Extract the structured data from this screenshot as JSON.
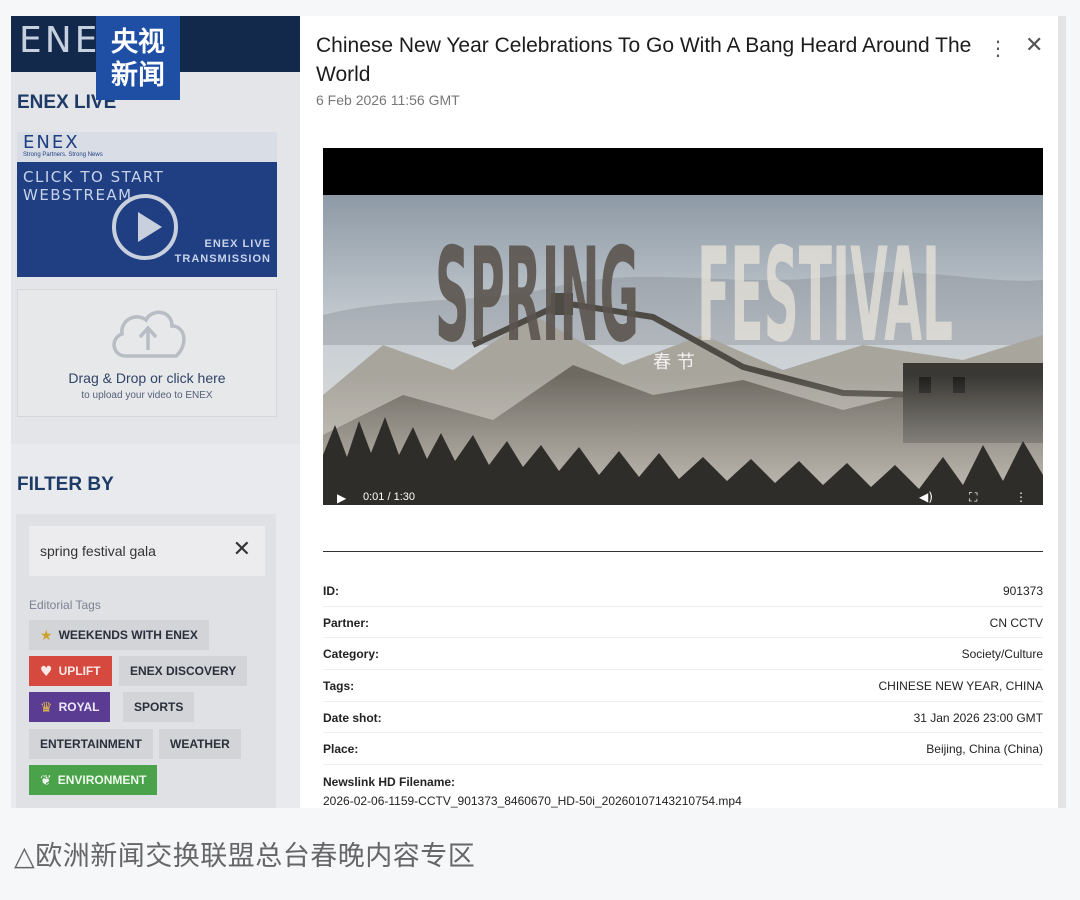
{
  "left_panel": {
    "logo_text": "ENEX",
    "cctv_badge_line1": "央视",
    "cctv_badge_line2": "新闻",
    "live_title": "ENEX LIVE",
    "stream": {
      "mini_logo": "ENEX",
      "tagline": "Strong Partners. Strong News",
      "click_text": "CLICK TO START WEBSTREAM",
      "live_line1": "ENEX LIVE",
      "live_line2": "TRANSMISSION"
    },
    "upload": {
      "icon": "cloud-upload-icon",
      "main": "Drag & Drop or click here",
      "sub": "to upload your video to ENEX"
    },
    "filter_title": "FILTER BY",
    "search_value": "spring festival gala",
    "editorial_tags_label": "Editorial Tags",
    "tags": {
      "weekends": "WEEKENDS WITH ENEX",
      "uplift": "UPLIFT",
      "discovery": "ENEX DISCOVERY",
      "royal": "ROYAL",
      "sports": "SPORTS",
      "entertainment": "ENTERTAINMENT",
      "weather": "WEATHER",
      "environment": "ENVIRONMENT"
    },
    "tag_colors": {
      "uplift": "#d6493f",
      "royal": "#5a3d92",
      "environment": "#4aa34a"
    }
  },
  "modal": {
    "title": "Chinese New Year Celebrations To Go With A Bang Heard Around The World",
    "date": "6 Feb 2026 11:56 GMT",
    "video": {
      "word1": "SPRING",
      "word2": "FESTIVAL",
      "subtitle": "春 节",
      "time": "0:01 / 1:30"
    },
    "metadata": [
      {
        "label": "ID:",
        "value": "901373"
      },
      {
        "label": "Partner:",
        "value": "CN CCTV"
      },
      {
        "label": "Category:",
        "value": "Society/Culture"
      },
      {
        "label": "Tags:",
        "value": "CHINESE NEW YEAR, CHINA"
      },
      {
        "label": "Date shot:",
        "value": "31 Jan 2026 23:00 GMT"
      },
      {
        "label": "Place:",
        "value": "Beijing, China (China)"
      }
    ],
    "filename_label": "Newslink HD Filename:",
    "filename_value": "2026-02-06-1159-CCTV_901373_8460670_HD-50i_20260107143210754.mp4"
  },
  "caption": "△欧洲新闻交换联盟总台春晚内容专区"
}
